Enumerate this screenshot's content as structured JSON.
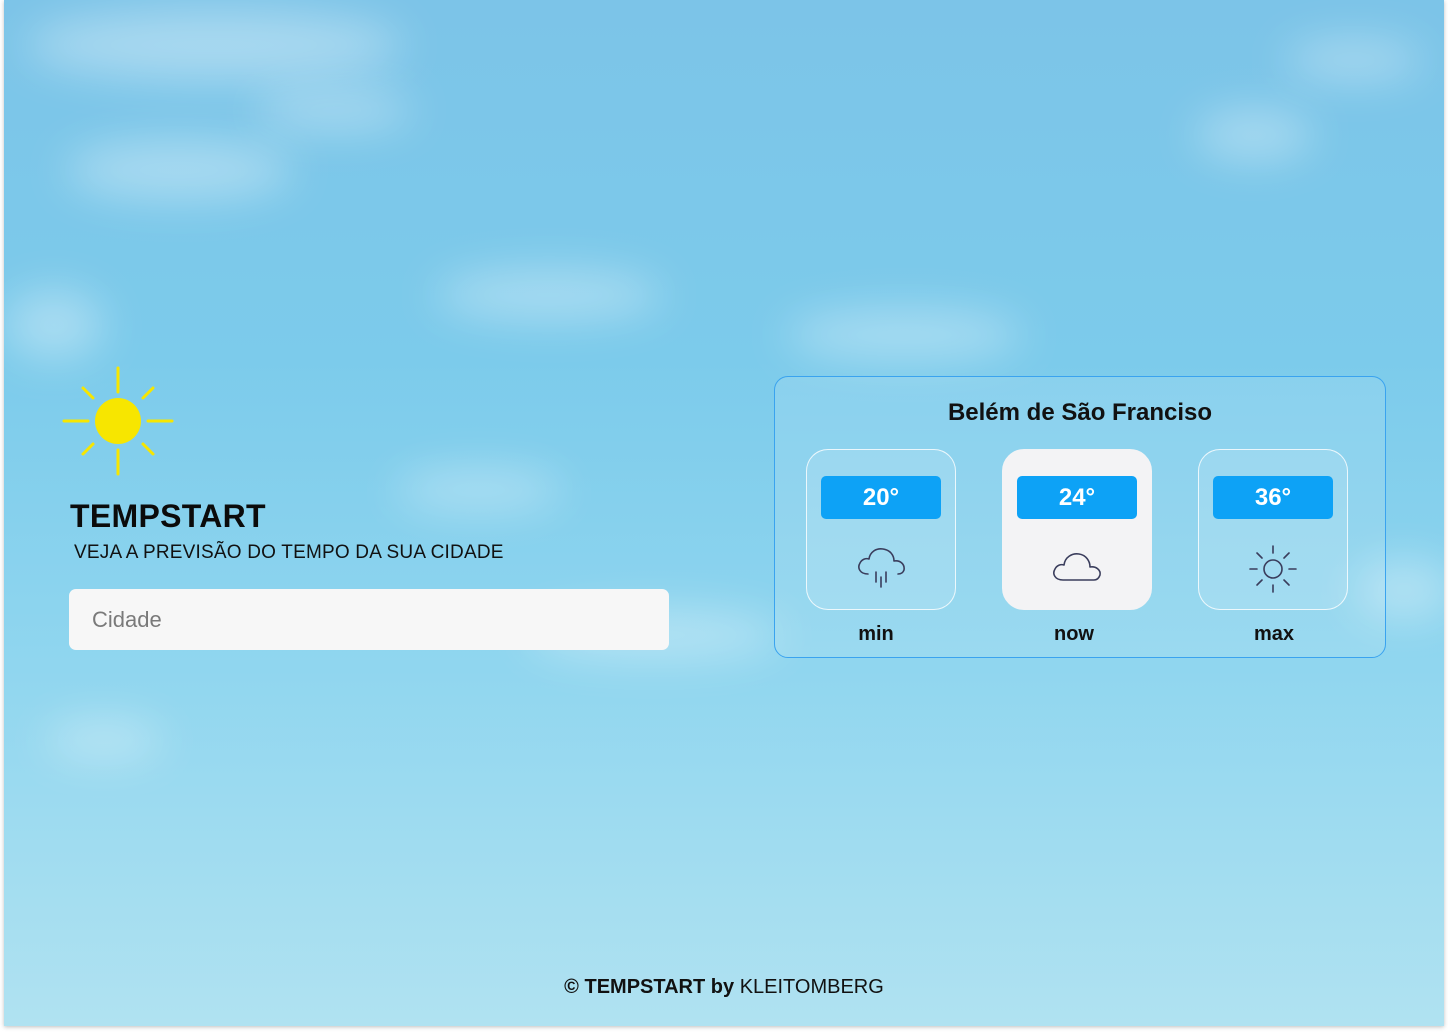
{
  "app": {
    "brand": "TEMPSTART",
    "tagline": "VEJA A PREVISÃO DO TEMPO DA SUA CIDADE",
    "logo_icon": "sun-icon",
    "accent_color": "#0da2f6",
    "sun_color": "#f7e600"
  },
  "search": {
    "placeholder": "Cidade",
    "value": ""
  },
  "weather": {
    "city": "Belém de São Franciso",
    "tiles": [
      {
        "key": "min",
        "temp": "20°",
        "label": "min",
        "icon": "cloud-rain-icon",
        "active": false
      },
      {
        "key": "now",
        "temp": "24°",
        "label": "now",
        "icon": "cloud-icon",
        "active": true
      },
      {
        "key": "max",
        "temp": "36°",
        "label": "max",
        "icon": "sun-icon",
        "active": false
      }
    ]
  },
  "footer": {
    "copyright_symbol": "©",
    "brand": "TEMPSTART",
    "by": "by",
    "author": "KLEITOMBERG"
  }
}
